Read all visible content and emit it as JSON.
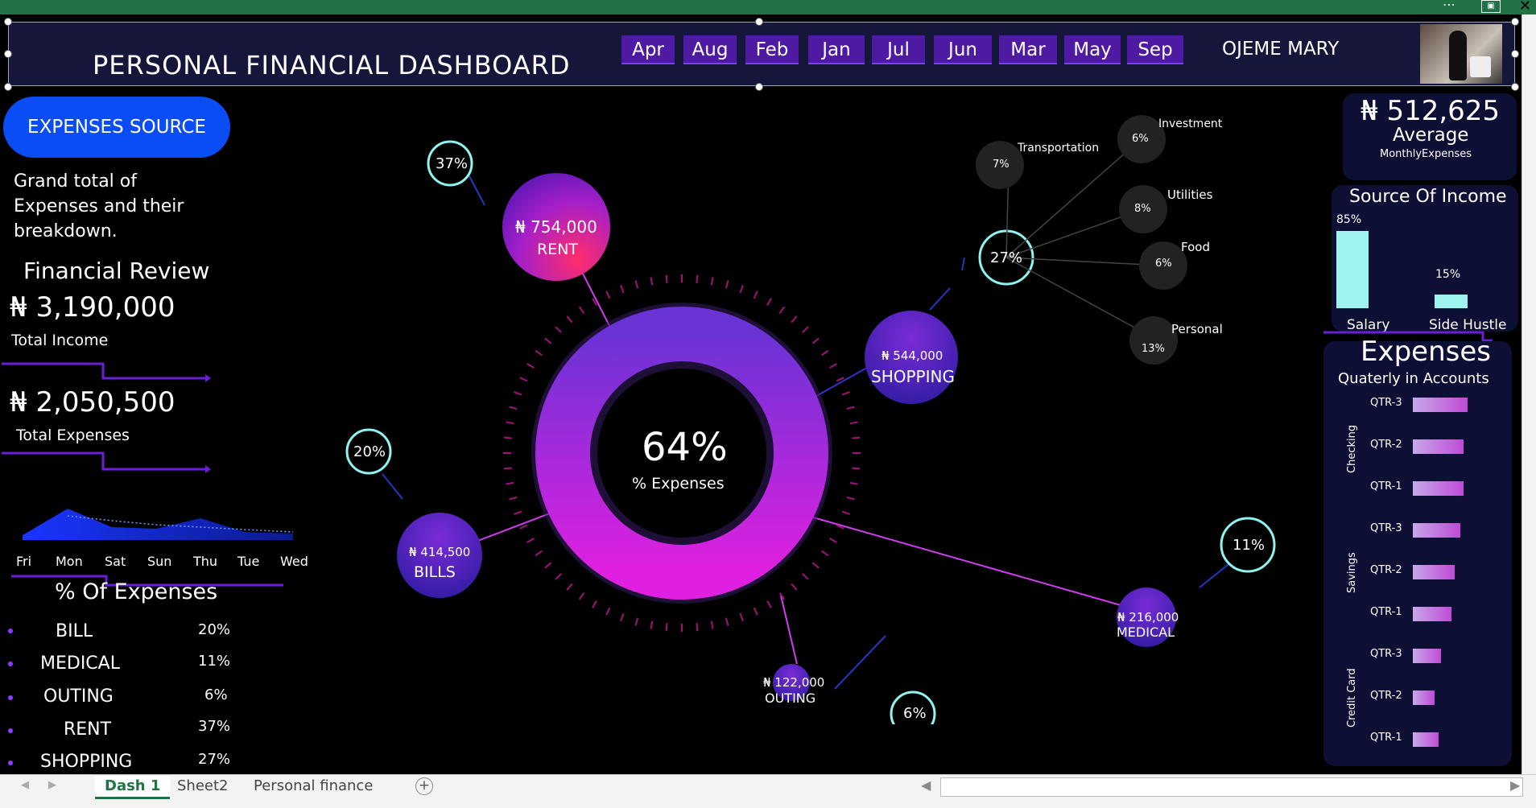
{
  "window": {
    "more_icon": "more-icon",
    "restore_icon": "restore-icon",
    "close_icon": "close-icon",
    "close_glyph": "✕",
    "more_glyph": "⋯"
  },
  "header": {
    "title": "PERSONAL FINANCIAL DASHBOARD",
    "months": [
      "Apr",
      "Aug",
      "Feb",
      "Jan",
      "Jul",
      "Jun",
      "Mar",
      "May",
      "Sep"
    ],
    "user_name": "OJEME MARY"
  },
  "left": {
    "expenses_source_label": "EXPENSES SOURCE",
    "description": "Grand total of Expenses and their breakdown.",
    "financial_review": "Financial Review",
    "total_income_value": "₦ 3,190,000",
    "total_income_label": "Total Income",
    "total_expenses_value": "₦ 2,050,500",
    "total_expenses_label": "Total Expenses",
    "days": [
      "Fri",
      "Mon",
      "Sat",
      "Sun",
      "Thu",
      "Tue",
      "Wed"
    ],
    "pct_title": "% Of Expenses",
    "pct_rows": [
      {
        "label": "BILL",
        "value": "20%"
      },
      {
        "label": "MEDICAL",
        "value": "11%"
      },
      {
        "label": "OUTING",
        "value": "6%"
      },
      {
        "label": "RENT",
        "value": "37%"
      },
      {
        "label": "SHOPPING",
        "value": "27%"
      }
    ]
  },
  "center": {
    "donut_value": "64%",
    "donut_label": "% Expenses",
    "donut_fraction": 0.64,
    "bubbles": [
      {
        "amount": "₦ 754,000",
        "label": "RENT",
        "pct": "37%"
      },
      {
        "amount": "₦ 544,000",
        "label": "SHOPPING",
        "pct": "27%"
      },
      {
        "amount": "₦ 414,500",
        "label": "BILLS",
        "pct": "20%"
      },
      {
        "amount": "₦ 216,000",
        "label": "MEDICAL",
        "pct": "11%"
      },
      {
        "amount": "₦ 122,000",
        "label": "OUTING",
        "pct": "6%"
      }
    ],
    "shopping_breakdown": [
      {
        "label": "Transportation",
        "pct": "7%"
      },
      {
        "label": "Investment",
        "pct": "6%"
      },
      {
        "label": "Utilities",
        "pct": "8%"
      },
      {
        "label": "Food",
        "pct": "6%"
      },
      {
        "label": "Personal",
        "pct": "13%"
      }
    ]
  },
  "right": {
    "average_value": "₦ 512,625",
    "average_label": "Average",
    "average_sub": "MonthlyExpenses",
    "source_income_title": "Source Of Income",
    "income_sources": [
      {
        "label": "Salary",
        "pct": "85%",
        "fraction": 0.85
      },
      {
        "label": "Side Hustle",
        "pct": "15%",
        "fraction": 0.15
      }
    ],
    "expenses_title": "Expenses",
    "expenses_sub": "Quaterly in Accounts",
    "accounts": [
      {
        "name": "Checking",
        "rows": [
          {
            "q": "QTR-3",
            "v": 0.95
          },
          {
            "q": "QTR-2",
            "v": 0.88
          },
          {
            "q": "QTR-1",
            "v": 0.88
          }
        ]
      },
      {
        "name": "Savings",
        "rows": [
          {
            "q": "QTR-3",
            "v": 0.82
          },
          {
            "q": "QTR-2",
            "v": 0.72
          },
          {
            "q": "QTR-1",
            "v": 0.66
          }
        ]
      },
      {
        "name": "Credit Card",
        "rows": [
          {
            "q": "QTR-3",
            "v": 0.48
          },
          {
            "q": "QTR-2",
            "v": 0.38
          },
          {
            "q": "QTR-1",
            "v": 0.44
          }
        ]
      }
    ]
  },
  "sheet_tabs": [
    "Dash 1",
    "Sheet2",
    "Personal finance"
  ],
  "add_sheet_icon": "add-sheet-icon",
  "add_glyph": "+"
}
